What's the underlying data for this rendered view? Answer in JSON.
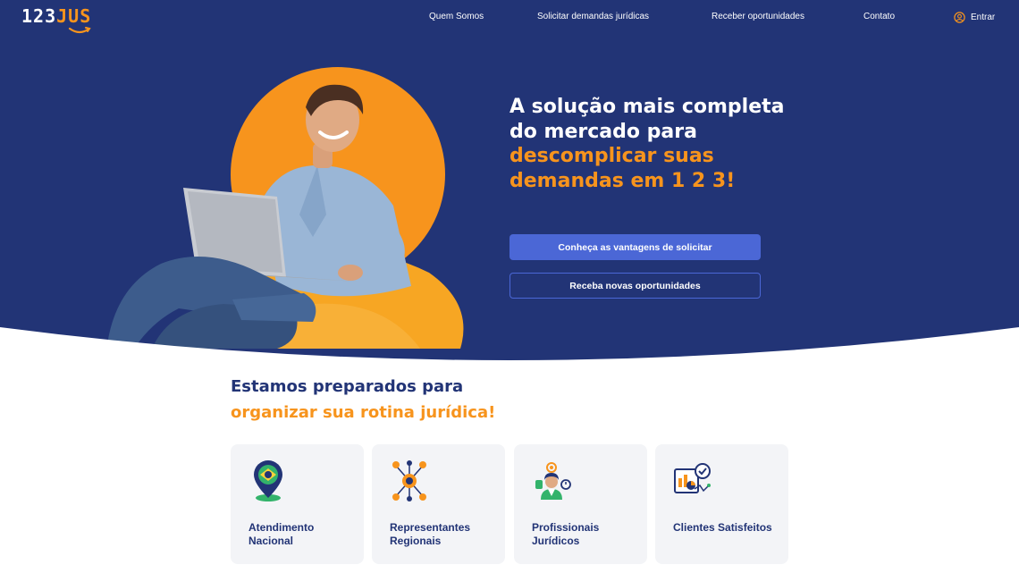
{
  "brand": {
    "logo_numbers": "123",
    "logo_text": "JUS"
  },
  "nav": {
    "items": [
      "Quem Somos",
      "Solicitar demandas jurídicas",
      "Receber oportunidades",
      "Contato"
    ],
    "login_label": "Entrar",
    "login_icon": "user-circle-icon"
  },
  "hero": {
    "headline_part1": "A solução mais completa do mercado para ",
    "headline_highlight": "descomplicar suas demandas em 1 2 3!",
    "primary_button": "Conheça as vantagens de solicitar",
    "secondary_button": "Receba novas oportunidades"
  },
  "section": {
    "title_line1": "Estamos preparados para",
    "title_line2": "organizar sua rotina jurídica!"
  },
  "cards": [
    {
      "label": "Atendimento Nacional",
      "icon": "brazil-location-icon"
    },
    {
      "label": "Representantes Regionais",
      "icon": "network-people-icon"
    },
    {
      "label": "Profissionais Jurídicos",
      "icon": "professional-icon"
    },
    {
      "label": "Clientes Satisfeitos",
      "icon": "report-check-icon"
    }
  ],
  "colors": {
    "navy": "#223476",
    "orange": "#f7941d",
    "button_blue": "#4b67d6",
    "card_bg": "#f3f4f7"
  }
}
